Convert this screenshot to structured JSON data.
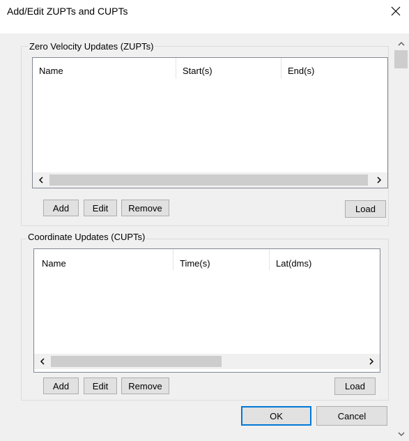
{
  "window": {
    "title": "Add/Edit ZUPTs and CUPTs",
    "close_icon": "close-icon"
  },
  "zupts": {
    "group_label": "Zero Velocity Updates (ZUPTs)",
    "columns": [
      "Name",
      "Start(s)",
      "End(s)"
    ],
    "rows": [],
    "buttons": {
      "add": "Add",
      "edit": "Edit",
      "remove": "Remove",
      "load": "Load"
    }
  },
  "cupts": {
    "group_label": "Coordinate Updates (CUPTs)",
    "columns": [
      "Name",
      "Time(s)",
      "Lat(dms)"
    ],
    "rows": [],
    "buttons": {
      "add": "Add",
      "edit": "Edit",
      "remove": "Remove",
      "load": "Load"
    }
  },
  "footer": {
    "ok": "OK",
    "cancel": "Cancel"
  },
  "colors": {
    "title_bar": "#ffffff",
    "client_background": "#f0f0f0",
    "list_background": "#ffffff",
    "button_face": "#e1e1e1",
    "button_border": "#adadad",
    "scroll_thumb": "#cdcdcd",
    "default_button_accent": "#0078d7"
  }
}
